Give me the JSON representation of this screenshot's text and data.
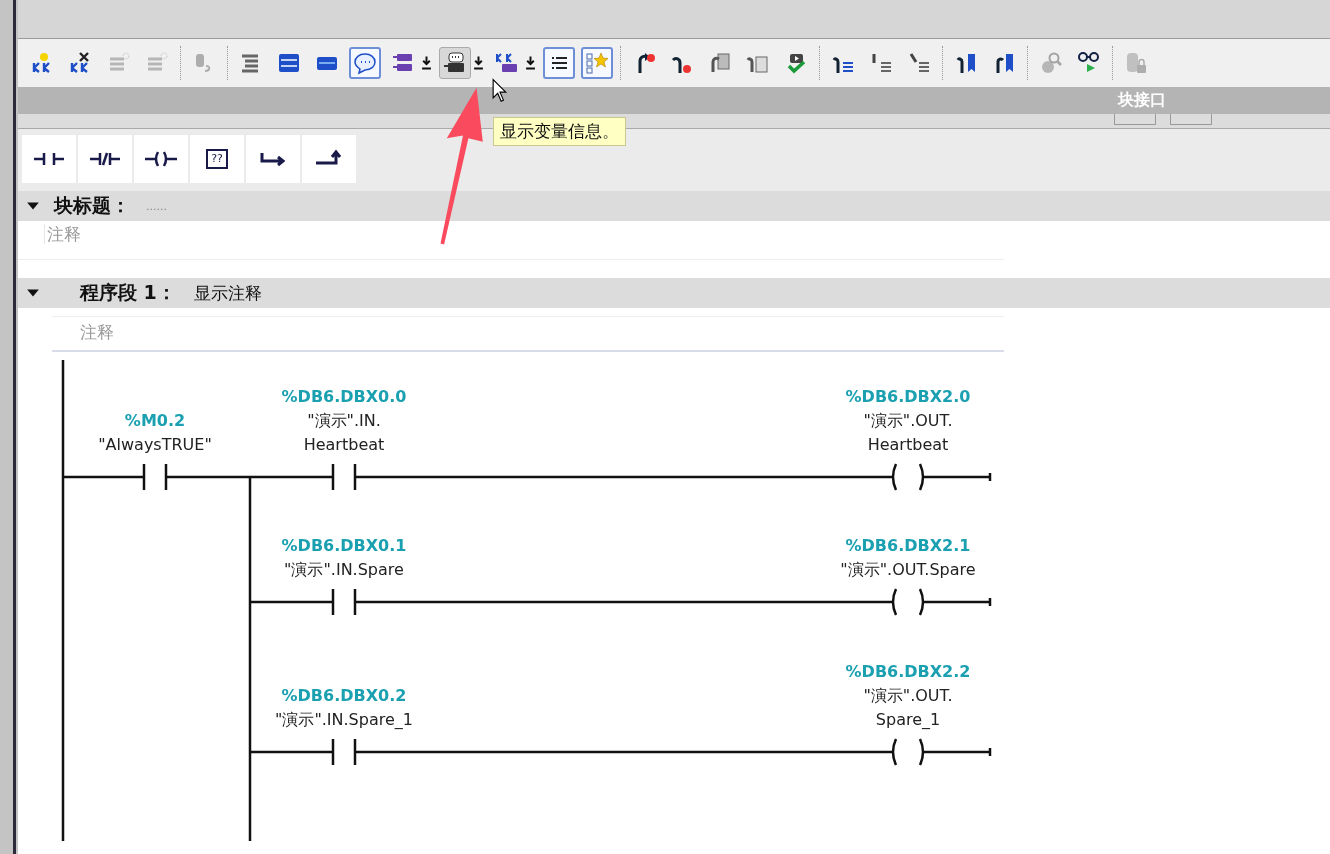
{
  "toolbar_groups": [
    [
      {
        "selected": false,
        "hovered": false,
        "disabled": false,
        "dropdown": false
      },
      {
        "selected": false,
        "hovered": false,
        "disabled": false,
        "dropdown": false
      },
      {
        "selected": false,
        "hovered": false,
        "disabled": true,
        "dropdown": false
      },
      {
        "selected": false,
        "hovered": false,
        "disabled": true,
        "dropdown": false
      }
    ],
    [
      {
        "selected": false,
        "hovered": false,
        "disabled": true,
        "dropdown": false
      }
    ],
    [
      {
        "selected": false,
        "hovered": false,
        "disabled": false,
        "dropdown": false
      },
      {
        "selected": false,
        "hovered": false,
        "disabled": false,
        "dropdown": false
      },
      {
        "selected": false,
        "hovered": false,
        "disabled": false,
        "dropdown": false
      },
      {
        "selected": true,
        "hovered": false,
        "disabled": false,
        "dropdown": false
      },
      {
        "selected": false,
        "hovered": false,
        "disabled": false,
        "dropdown": true
      },
      {
        "selected": false,
        "hovered": true,
        "disabled": false,
        "dropdown": true
      },
      {
        "selected": false,
        "hovered": false,
        "disabled": false,
        "dropdown": true
      },
      {
        "selected": true,
        "hovered": false,
        "disabled": false,
        "dropdown": false
      },
      {
        "selected": true,
        "hovered": false,
        "disabled": false,
        "dropdown": false
      }
    ],
    [
      {
        "selected": false,
        "hovered": false,
        "disabled": false,
        "dropdown": false
      },
      {
        "selected": false,
        "hovered": false,
        "disabled": false,
        "dropdown": false
      },
      {
        "selected": false,
        "hovered": false,
        "disabled": false,
        "dropdown": false
      },
      {
        "selected": false,
        "hovered": false,
        "disabled": false,
        "dropdown": false
      },
      {
        "selected": false,
        "hovered": false,
        "disabled": false,
        "dropdown": false
      }
    ],
    [
      {
        "selected": false,
        "hovered": false,
        "disabled": false,
        "dropdown": false
      },
      {
        "selected": false,
        "hovered": false,
        "disabled": false,
        "dropdown": false
      },
      {
        "selected": false,
        "hovered": false,
        "disabled": false,
        "dropdown": false
      }
    ],
    [
      {
        "selected": false,
        "hovered": false,
        "disabled": false,
        "dropdown": false
      },
      {
        "selected": false,
        "hovered": false,
        "disabled": false,
        "dropdown": false
      }
    ],
    [
      {
        "selected": false,
        "hovered": false,
        "disabled": true,
        "dropdown": false
      },
      {
        "selected": false,
        "hovered": false,
        "disabled": false,
        "dropdown": false
      }
    ],
    [
      {
        "selected": false,
        "hovered": false,
        "disabled": true,
        "dropdown": false
      }
    ]
  ],
  "interface_bar": {
    "title": "块接口"
  },
  "tooltip": {
    "text": "显示变量信息。"
  },
  "palette": [
    {
      "kind": "no_contact"
    },
    {
      "kind": "nc_contact"
    },
    {
      "kind": "coil"
    },
    {
      "kind": "box",
      "label": "??"
    },
    {
      "kind": "open_branch"
    },
    {
      "kind": "close_branch"
    }
  ],
  "block_title": {
    "label": "块标题：",
    "placeholder": "......",
    "expanded": true,
    "comment": "注释"
  },
  "network": {
    "label": "程序段 1：",
    "title": "显示注释",
    "expanded": true,
    "comment": "注释"
  },
  "ladder": {
    "input": {
      "address": "%M0.2",
      "symbol_lines": [
        "\"AlwaysTRUE\""
      ]
    },
    "rungs": [
      {
        "contact": {
          "address": "%DB6.DBX0.0",
          "symbol_lines": [
            "\"演示\".IN.",
            "Heartbeat"
          ]
        },
        "coil": {
          "address": "%DB6.DBX2.0",
          "symbol_lines": [
            "\"演示\".OUT.",
            "Heartbeat"
          ]
        }
      },
      {
        "contact": {
          "address": "%DB6.DBX0.1",
          "symbol_lines": [
            "\"演示\".IN.Spare"
          ]
        },
        "coil": {
          "address": "%DB6.DBX2.1",
          "symbol_lines": [
            "\"演示\".OUT.Spare"
          ]
        }
      },
      {
        "contact": {
          "address": "%DB6.DBX0.2",
          "symbol_lines": [
            "\"演示\".IN.Spare_1"
          ]
        },
        "coil": {
          "address": "%DB6.DBX2.2",
          "symbol_lines": [
            "\"演示\".OUT.",
            "Spare_1"
          ]
        }
      }
    ]
  }
}
